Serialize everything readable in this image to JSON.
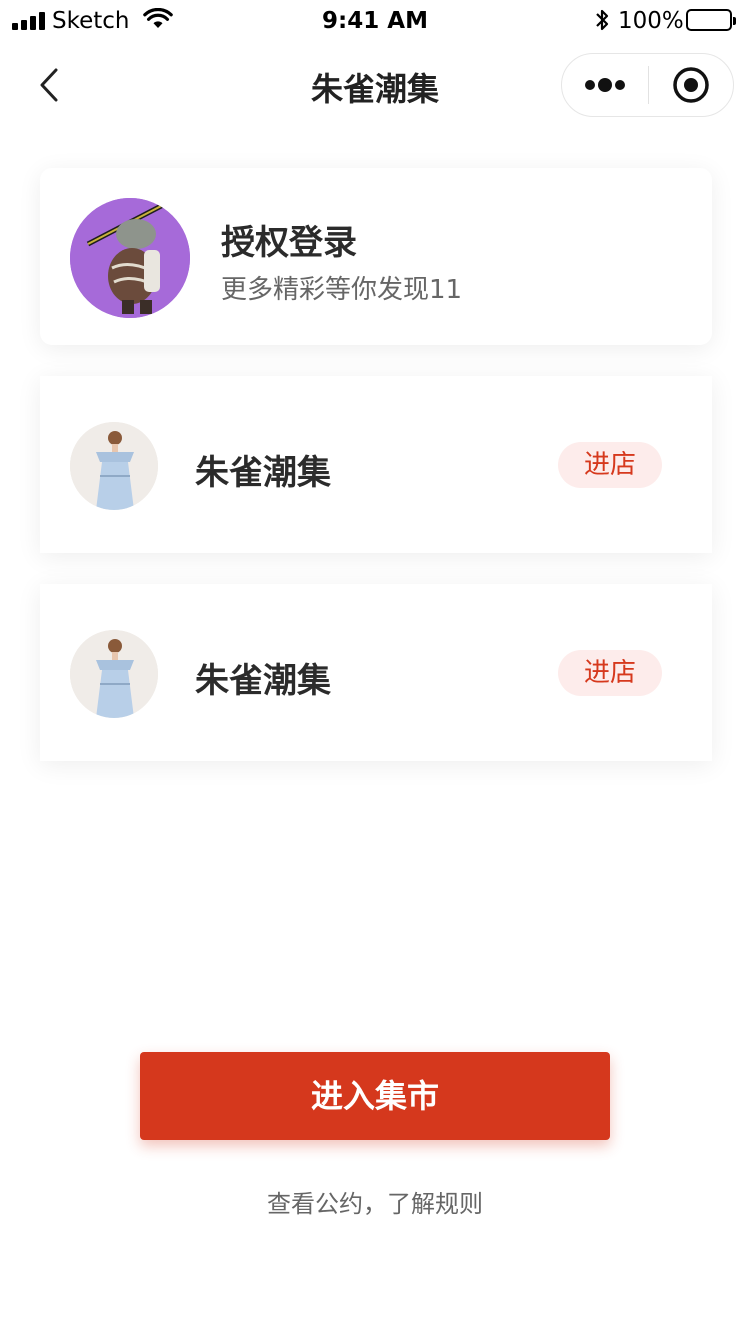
{
  "status_bar": {
    "carrier": "Sketch",
    "time": "9:41 AM",
    "battery": "100%"
  },
  "nav": {
    "title": "朱雀潮集",
    "icons": [
      "back-chevron-icon",
      "more-dots-icon",
      "close-target-icon"
    ]
  },
  "login_card": {
    "title": "授权登录",
    "subtitle": "更多精彩等你发现11",
    "avatar_bg": "#a66ad9"
  },
  "shops": [
    {
      "name": "朱雀潮集",
      "enter_label": "进店"
    },
    {
      "name": "朱雀潮集",
      "enter_label": "进店"
    }
  ],
  "footer": {
    "enter_button": "进入集市",
    "rules_link": "查看公约，了解规则"
  },
  "colors": {
    "accent": "#d5381d",
    "enter_badge_bg": "#fdeceb",
    "enter_badge_text": "#d6391d"
  }
}
